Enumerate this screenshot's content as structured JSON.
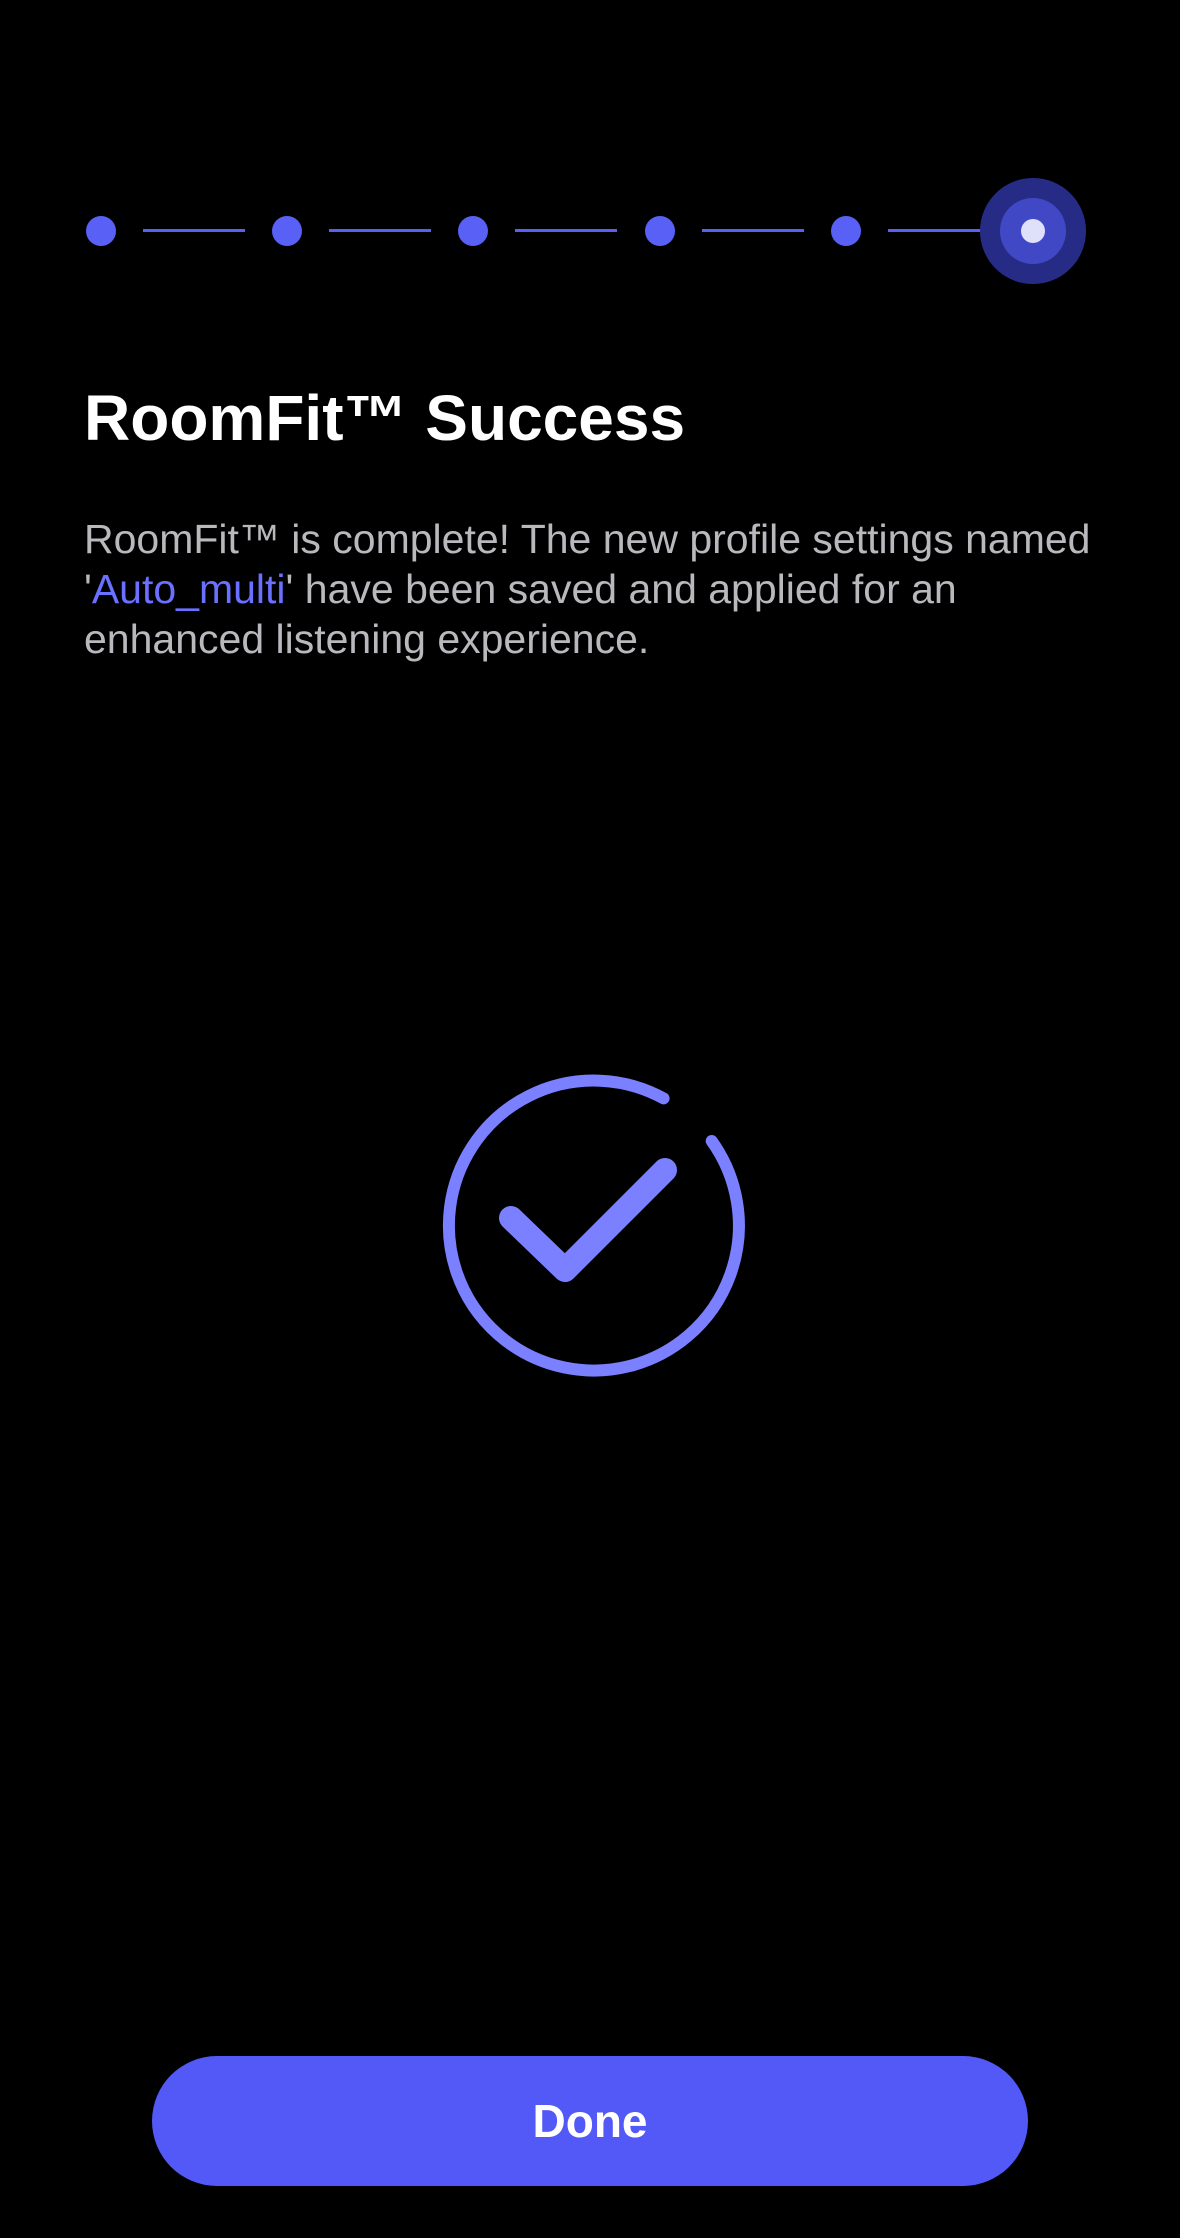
{
  "progress": {
    "total_steps": 6,
    "current_step": 6,
    "accent_color": "#5860f5",
    "current_glow_color": "#262c86"
  },
  "screen": {
    "title": "RoomFit™ Success",
    "description_before": "RoomFit™ is complete! The new profile settings named '",
    "profile_name": "Auto_multi",
    "description_after": "' have been saved and applied for an enhanced listening experience."
  },
  "success_icon": {
    "name": "check-circle-icon",
    "color": "#7a80ff"
  },
  "actions": {
    "done_label": "Done"
  },
  "theme": {
    "background": "#000000",
    "button_color": "#5259f7",
    "highlight_text_color": "#6a70ff"
  }
}
